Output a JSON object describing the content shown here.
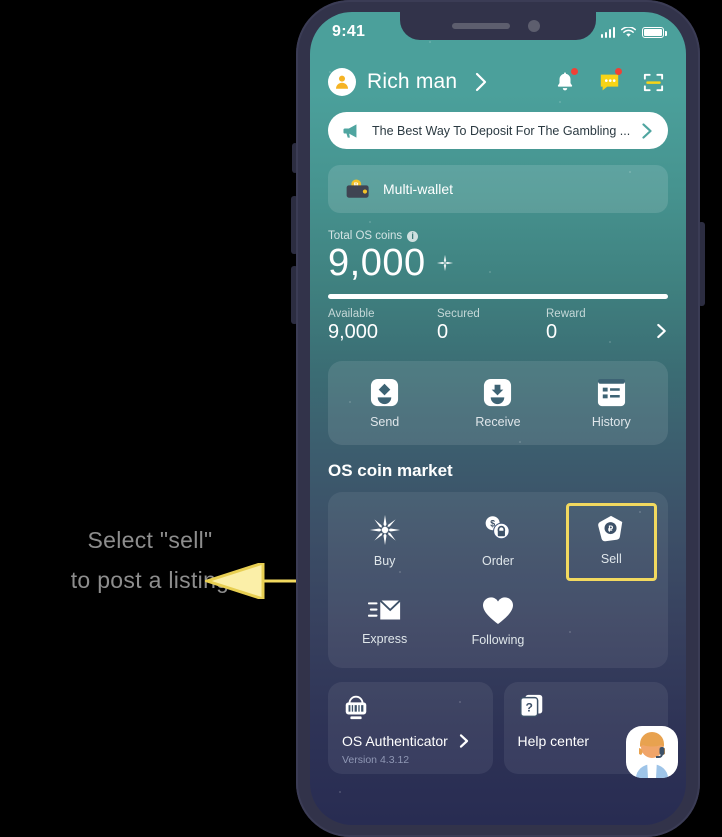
{
  "annotation": {
    "line1": "Select \"sell\"",
    "line2": "to post a listing",
    "arrow_color": "#f2d95f",
    "text_color": "#8d8d8d"
  },
  "phone": {
    "frame_color": "#32334a",
    "screen_gradient_top": "#4ba09b",
    "screen_gradient_bottom": "#282c52"
  },
  "statusbar": {
    "clock": "9:41",
    "signal_icon": "signal-bars-icon",
    "wifi_icon": "wifi-icon",
    "battery_icon": "battery-full-icon"
  },
  "header": {
    "avatar_icon": "user-avatar-icon",
    "username": "Rich man",
    "chevron_icon": "chevron-right-icon",
    "icons": [
      {
        "name": "bell-icon",
        "badge": true
      },
      {
        "name": "chat-icon",
        "badge": true
      },
      {
        "name": "scan-icon",
        "badge": false
      }
    ]
  },
  "banner": {
    "icon": "megaphone-icon",
    "text": "The Best Way To Deposit For The Gambling ...",
    "chevron_icon": "chevron-right-icon"
  },
  "wallet": {
    "icon": "wallet-coin-icon",
    "label": "Multi-wallet"
  },
  "balance": {
    "caption": "Total OS coins",
    "info_icon": "info-icon",
    "info_glyph": "i",
    "amount": "9,000",
    "spark_icon": "sparkle-icon",
    "progress_percent": 100,
    "stats": [
      {
        "label": "Available",
        "value": "9,000"
      },
      {
        "label": "Secured",
        "value": "0"
      },
      {
        "label": "Reward",
        "value": "0"
      }
    ],
    "chevron_icon": "chevron-right-icon"
  },
  "actions": [
    {
      "icon": "send-icon",
      "label": "Send"
    },
    {
      "icon": "receive-icon",
      "label": "Receive"
    },
    {
      "icon": "history-icon",
      "label": "History"
    }
  ],
  "market": {
    "title": "OS coin market",
    "items": [
      {
        "icon": "buy-burst-icon",
        "label": "Buy",
        "selected": false
      },
      {
        "icon": "order-coins-icon",
        "label": "Order",
        "selected": false
      },
      {
        "icon": "sell-tag-icon",
        "label": "Sell",
        "selected": true
      },
      {
        "icon": "express-mail-icon",
        "label": "Express",
        "selected": false
      },
      {
        "icon": "heart-icon",
        "label": "Following",
        "selected": false
      }
    ],
    "highlight_color": "#f2d95f"
  },
  "bottom_cards": {
    "authenticator": {
      "icon": "authenticator-icon",
      "title": "OS Authenticator",
      "chevron_icon": "chevron-right-icon",
      "version": "Version 4.3.12"
    },
    "help": {
      "icon": "question-doc-icon",
      "title": "Help center",
      "support_avatar_icon": "support-agent-avatar-icon"
    }
  }
}
